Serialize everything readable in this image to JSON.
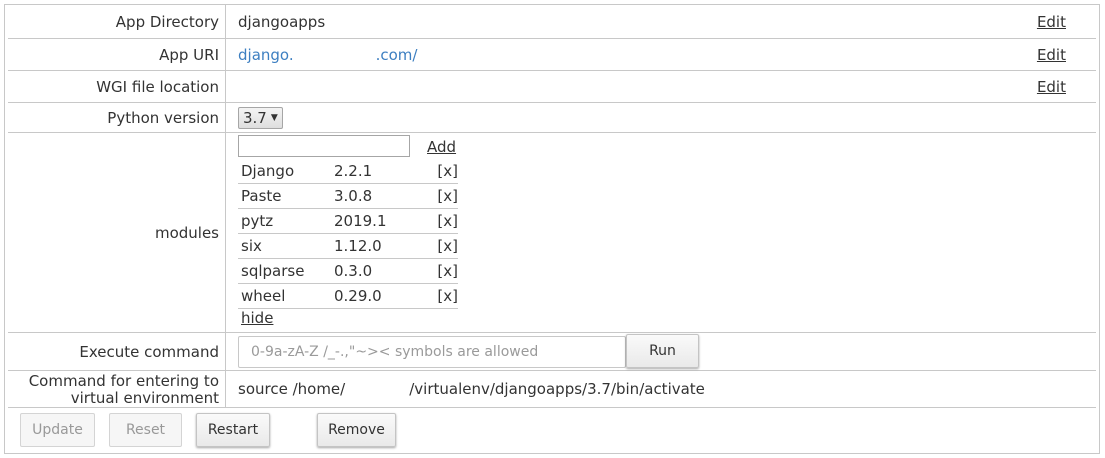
{
  "app_directory": {
    "label": "App Directory",
    "value": "djangoapps",
    "edit": "Edit"
  },
  "app_uri": {
    "label": "App URI",
    "prefix": "django.",
    "suffix": ".com/",
    "edit": "Edit"
  },
  "wsgi": {
    "label": "WGI file location",
    "value": "",
    "edit": "Edit"
  },
  "python_version": {
    "label": "Python version",
    "selected": "3.7"
  },
  "modules": {
    "label": "modules",
    "add_label": "Add",
    "input_value": "",
    "items": [
      {
        "name": "Django",
        "version": "2.2.1",
        "remove": "[x]"
      },
      {
        "name": "Paste",
        "version": "3.0.8",
        "remove": "[x]"
      },
      {
        "name": "pytz",
        "version": "2019.1",
        "remove": "[x]"
      },
      {
        "name": "six",
        "version": "1.12.0",
        "remove": "[x]"
      },
      {
        "name": "sqlparse",
        "version": "0.3.0",
        "remove": "[x]"
      },
      {
        "name": "wheel",
        "version": "0.29.0",
        "remove": "[x]"
      }
    ],
    "hide_label": "hide"
  },
  "execute": {
    "label": "Execute command",
    "placeholder": "0-9a-zA-Z /_-.,\"~>< symbols are allowed",
    "run_label": "Run"
  },
  "venv": {
    "label_line1": "Command for entering to",
    "label_line2": "virtual environment",
    "prefix": "source /home/",
    "suffix": "/virtualenv/djangoapps/3.7/bin/activate"
  },
  "actions": {
    "update": "Update",
    "reset": "Reset",
    "restart": "Restart",
    "remove": "Remove"
  },
  "colors": {
    "link": "#3d7fc1",
    "border": "#c8c8c8",
    "text": "#333333"
  }
}
